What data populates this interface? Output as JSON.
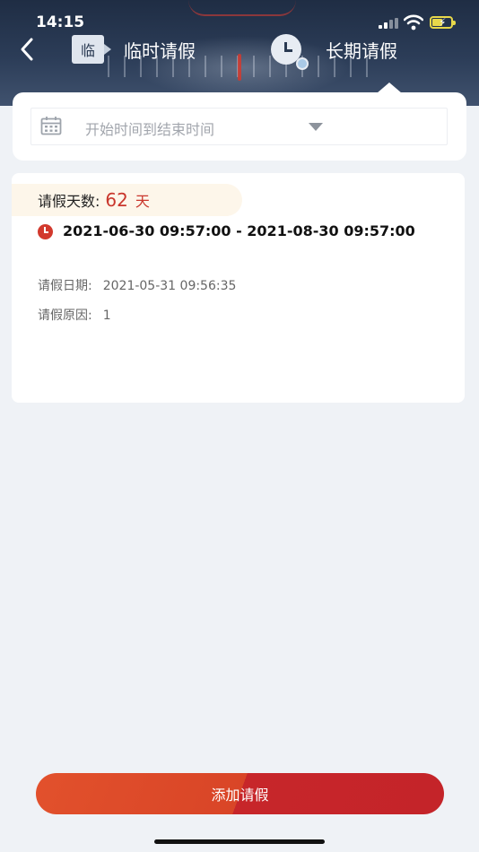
{
  "status_bar": {
    "time": "14:15"
  },
  "header": {
    "tabs": [
      {
        "label": "临时请假",
        "icon_glyph": "临",
        "icon": "temp-leave-icon"
      },
      {
        "label": "长期请假",
        "icon": "clock-icon"
      }
    ],
    "active_tab": 1
  },
  "filter": {
    "placeholder": "开始时间到结束时间"
  },
  "record": {
    "days_label": "请假天数:",
    "days_value": "62",
    "days_unit": "天",
    "range": "2021-06-30 09:57:00 - 2021-08-30 09:57:00",
    "date_label": "请假日期:",
    "date_value": "2021-05-31 09:56:35",
    "reason_label": "请假原因:",
    "reason_value": "1"
  },
  "actions": {
    "add_label": "添加请假"
  },
  "colors": {
    "accent": "#c9362c",
    "header": "#2c3d58",
    "button_start": "#e2512c",
    "button_end": "#c42429"
  }
}
